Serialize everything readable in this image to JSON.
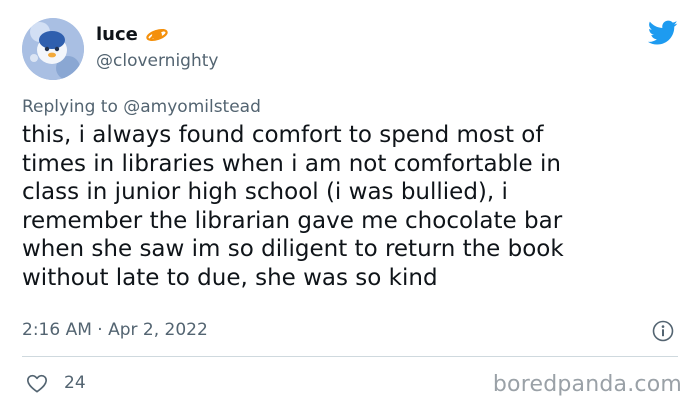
{
  "author": {
    "display_name": "luce",
    "handle": "@clovernighty",
    "name_emoji": "ringed-planet-icon",
    "avatar": "blue-plush-avatar"
  },
  "reply_context": {
    "prefix": "Replying to",
    "mention": "@amyomilstead"
  },
  "tweet": {
    "lines": [
      "this, i always found comfort to spend most of",
      "times in libraries when i am not comfortable in",
      "class in junior high school (i was bullied), i",
      "remember the librarian gave me chocolate bar",
      "when she saw im so diligent to return the book",
      "without late to due, she was so kind"
    ],
    "timestamp": "2:16 AM · Apr 2, 2022",
    "like_count": "24"
  },
  "icons": {
    "brand": "twitter-bird-icon",
    "info": "info-icon",
    "like": "heart-icon"
  },
  "colors": {
    "twitter_blue": "#1d9bf0",
    "secondary_text": "#536471",
    "emoji_orange": "#f4900c"
  },
  "watermark": "boredpanda.com"
}
